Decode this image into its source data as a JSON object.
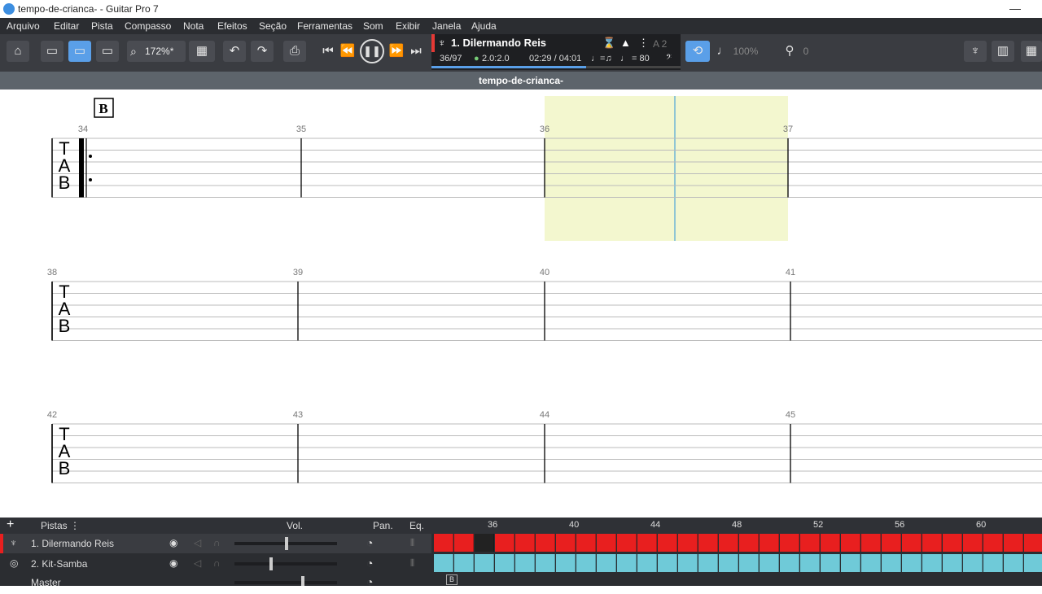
{
  "window": {
    "title": "tempo-de-crianca- - Guitar Pro 7",
    "minimize_glyph": "—"
  },
  "menu": [
    "Arquivo",
    "Editar",
    "Pista",
    "Compasso",
    "Nota",
    "Efeitos",
    "Seção",
    "Ferramentas",
    "Som",
    "Exibir",
    "Janela",
    "Ajuda"
  ],
  "toolbar": {
    "zoom": "172%*",
    "icons": [
      "home-icon",
      "panel-left-icon",
      "panel-bottom-icon",
      "panel-right-icon",
      "zoom-icon",
      "layout-icon",
      "undo-icon",
      "redo-icon",
      "print-icon",
      "skip-start-icon",
      "rewind-icon",
      "pause-icon",
      "forward-icon",
      "skip-end-icon"
    ]
  },
  "lcd": {
    "track": "1. Dilermando Reis",
    "bar": "36/97",
    "beat": "2.0:2.0",
    "time": "02:29 / 04:01",
    "tempo_label": "♩ = 80",
    "rhythm_label": "♩=♫",
    "progress": 0.62,
    "key_indicator": "A 2"
  },
  "right_toolbar": {
    "speed": "100%",
    "capo": "0"
  },
  "document": {
    "name": "tempo-de-crianca-"
  },
  "score": {
    "section_marker": "B",
    "systems": [
      {
        "bars": [
          "34",
          "35",
          "36",
          "37"
        ]
      },
      {
        "bars": [
          "38",
          "39",
          "40",
          "41"
        ]
      },
      {
        "bars": [
          "42",
          "43",
          "44",
          "45"
        ]
      }
    ]
  },
  "tracks_panel": {
    "header": {
      "tracks_label": "Pistas",
      "vol_label": "Vol.",
      "pan_label": "Pan.",
      "eq_label": "Eq."
    },
    "timeline_bars": [
      "36",
      "40",
      "44",
      "48",
      "52",
      "56",
      "60"
    ],
    "tracks": [
      {
        "name": "1. Dilermando Reis",
        "color": "#e81f1f"
      },
      {
        "name": "2. Kit-Samba",
        "color": "#6fcad8"
      }
    ],
    "master": "Master",
    "section_flag": "B"
  }
}
